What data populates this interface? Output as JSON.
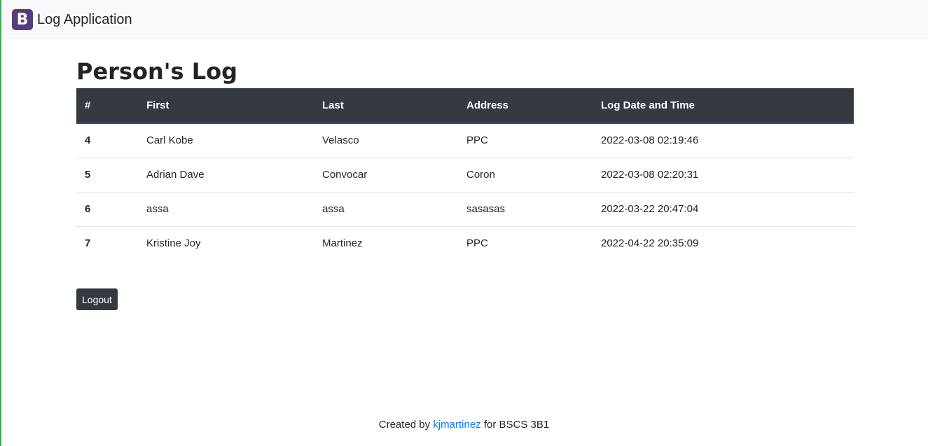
{
  "colors": {
    "navbar_bg": "#f8f9fa",
    "brand_logo_bg": "#563d7c",
    "table_header_bg": "#343a40",
    "link": "#007bff",
    "left_edge": "#2fb344"
  },
  "navbar": {
    "logo_letter": "B",
    "title": "Log Application"
  },
  "page": {
    "heading": "Person's Log"
  },
  "table": {
    "headers": [
      "#",
      "First",
      "Last",
      "Address",
      "Log Date and Time"
    ],
    "rows": [
      {
        "id": "4",
        "first": "Carl Kobe",
        "last": "Velasco",
        "address": "PPC",
        "datetime": "2022-03-08 02:19:46"
      },
      {
        "id": "5",
        "first": "Adrian Dave",
        "last": "Convocar",
        "address": "Coron",
        "datetime": "2022-03-08 02:20:31"
      },
      {
        "id": "6",
        "first": "assa",
        "last": "assa",
        "address": "sasasas",
        "datetime": "2022-03-22 20:47:04"
      },
      {
        "id": "7",
        "first": "Kristine Joy",
        "last": "Martinez",
        "address": "PPC",
        "datetime": "2022-04-22 20:35:09"
      }
    ]
  },
  "actions": {
    "logout_label": "Logout"
  },
  "footer": {
    "prefix": "Created by",
    "author_link": "kjmartinez",
    "suffix": "for BSCS 3B1"
  }
}
